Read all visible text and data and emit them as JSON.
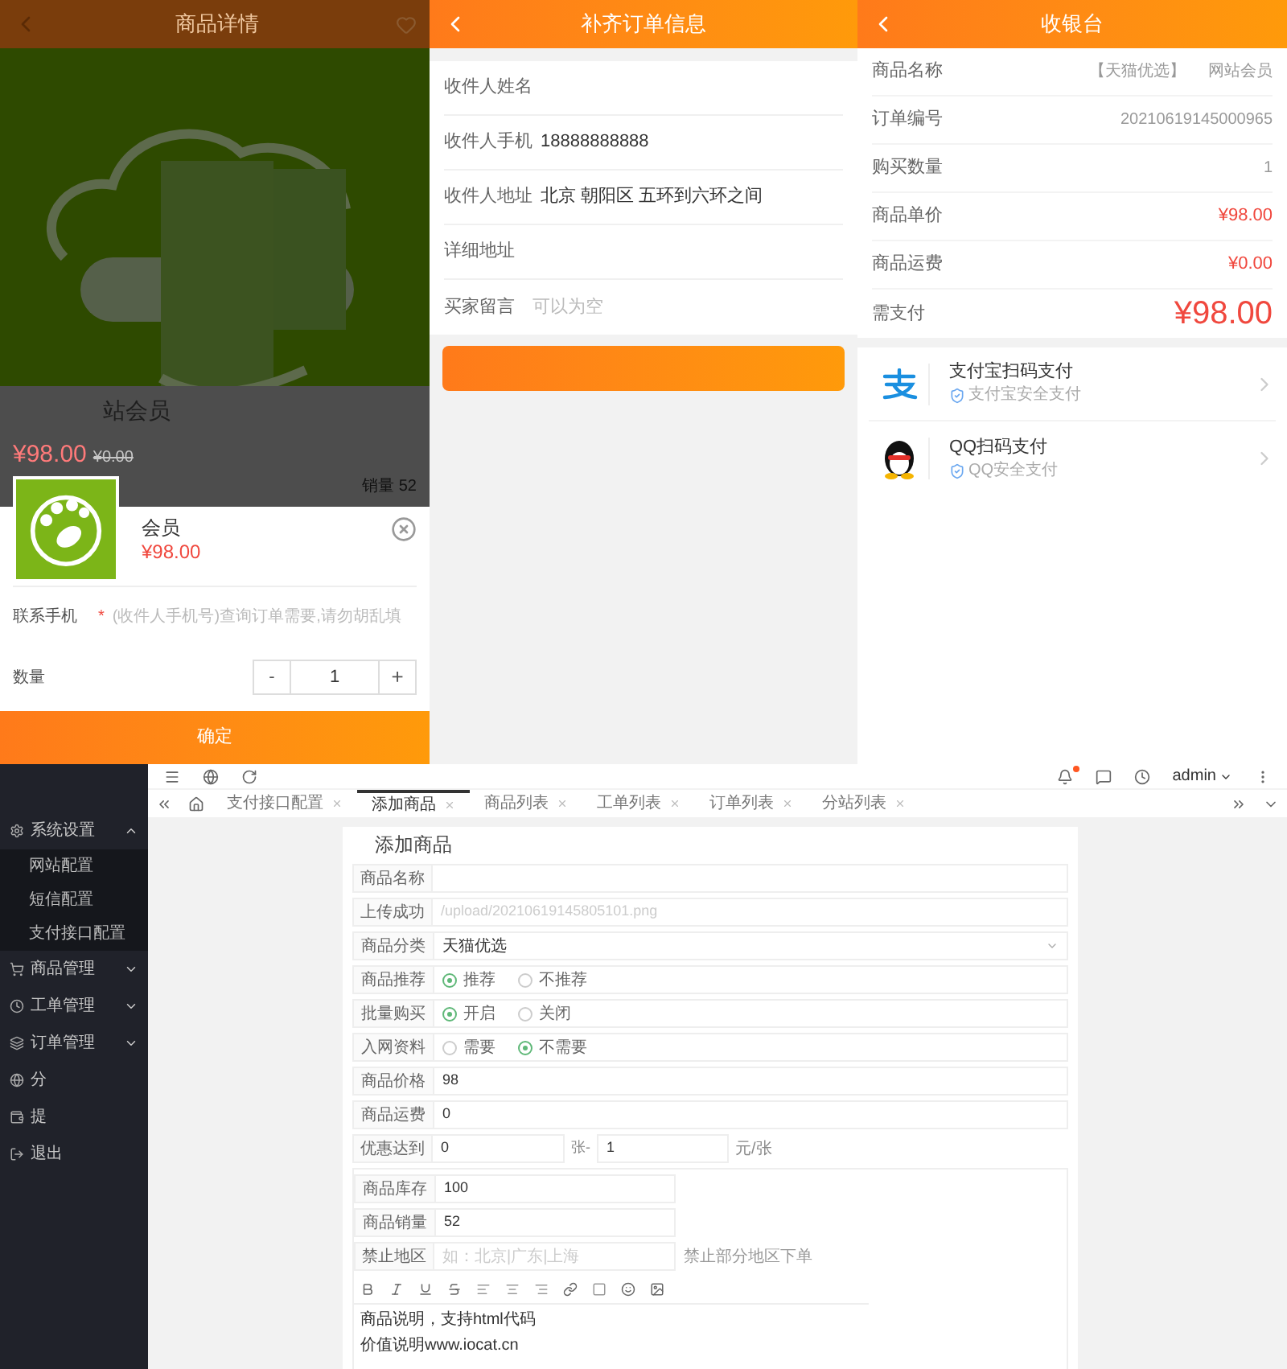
{
  "product_page": {
    "title": "商品详情",
    "product_name": "站会员",
    "price": "¥98.00",
    "old_price": "¥0.00",
    "sales": "销量 52",
    "sheet": {
      "name": "会员",
      "price": "¥98.00",
      "phone_label": "联系手机",
      "required_mark": "*",
      "phone_placeholder": "(收件人手机号)查询订单需要,请勿胡乱填",
      "qty_label": "数量",
      "minus": "-",
      "qty": "1",
      "plus": "+"
    },
    "confirm": "确定"
  },
  "order_info": {
    "title": "补齐订单信息",
    "fields": [
      {
        "label": "收件人姓名"
      },
      {
        "label": "收件人手机",
        "value": "18888888888"
      },
      {
        "label": "收件人地址",
        "value": "北京 朝阳区 五环到六环之间"
      },
      {
        "label": "详细地址"
      },
      {
        "label": "买家留言",
        "placeholder": "可以为空"
      }
    ]
  },
  "cashier": {
    "title": "收银台",
    "rows": [
      {
        "kind": "plain",
        "label": "商品名称",
        "value": "【天猫优选】",
        "value_2": "网站会员"
      },
      {
        "kind": "plain",
        "label": "订单编号",
        "value": "20210619145000965"
      },
      {
        "kind": "plain",
        "label": "购买数量",
        "value": "1"
      },
      {
        "kind": "price",
        "label": "商品单价",
        "value": "¥98.00"
      },
      {
        "kind": "price",
        "label": "商品运费",
        "value": "¥0.00"
      },
      {
        "kind": "total",
        "label": "需支付",
        "value": "¥98.00"
      }
    ],
    "payments": [
      {
        "kind": "alipay",
        "name": "支付宝扫码支付",
        "note": "支付宝安全支付"
      },
      {
        "kind": "qq",
        "name": "QQ扫码支付",
        "note": "QQ安全支付"
      }
    ]
  },
  "admin": {
    "sidebar": [
      {
        "label": "系统设置",
        "expanded": true,
        "children": [
          {
            "label": "网站配置"
          },
          {
            "label": "短信配置"
          },
          {
            "label": "支付接口配置"
          }
        ]
      },
      {
        "label": "商品管理",
        "expanded": false
      },
      {
        "label": "工单管理",
        "expanded": false
      },
      {
        "label": "订单管理",
        "expanded": false
      },
      {
        "label": "分"
      },
      {
        "label": "提"
      },
      {
        "label": "退出"
      }
    ],
    "user": "admin",
    "tabs": [
      {
        "label": "支付接口配置",
        "selected": false
      },
      {
        "label": "添加商品",
        "selected": true
      },
      {
        "label": "商品列表",
        "selected": false
      },
      {
        "label": "工单列表",
        "selected": false
      },
      {
        "label": "订单列表",
        "selected": false
      },
      {
        "label": "分站列表",
        "selected": false
      }
    ],
    "form": {
      "title": "添加商品",
      "rows": [
        {
          "kind": "text",
          "label": "商品名称"
        },
        {
          "kind": "text",
          "label": "上传成功",
          "placeholder": "/upload/20210619145805101.png"
        },
        {
          "kind": "select",
          "label": "商品分类",
          "value": "天猫优选"
        },
        {
          "kind": "radio",
          "label": "商品推荐",
          "options": [
            {
              "label": "推荐",
              "selected": true
            },
            {
              "label": "不推荐",
              "selected": false
            }
          ]
        },
        {
          "kind": "radio",
          "label": "批量购买",
          "options": [
            {
              "label": "开启",
              "selected": true
            },
            {
              "label": "关闭",
              "selected": false
            }
          ]
        },
        {
          "kind": "radio",
          "label": "入网资料",
          "options": [
            {
              "label": "需要",
              "selected": false
            },
            {
              "label": "不需要",
              "selected": true
            }
          ]
        },
        {
          "kind": "text",
          "label": "商品价格",
          "value": "98"
        },
        {
          "kind": "text",
          "label": "商品运费",
          "value": "0"
        },
        {
          "kind": "range",
          "label": "优惠达到",
          "value": "0",
          "separator": "张-",
          "value_2": "1",
          "unit": "元/张"
        }
      ],
      "side_rows": [
        {
          "label": "商品库存",
          "value": "100"
        },
        {
          "label": "商品销量",
          "value": "52"
        },
        {
          "label": "禁止地区",
          "placeholder": "如：北京|广东|上海",
          "hint": "禁止部分地区下单"
        }
      ],
      "editor_lines": [
        "商品说明，支持html代码",
        "价值说明www.iocat.cn"
      ]
    }
  }
}
